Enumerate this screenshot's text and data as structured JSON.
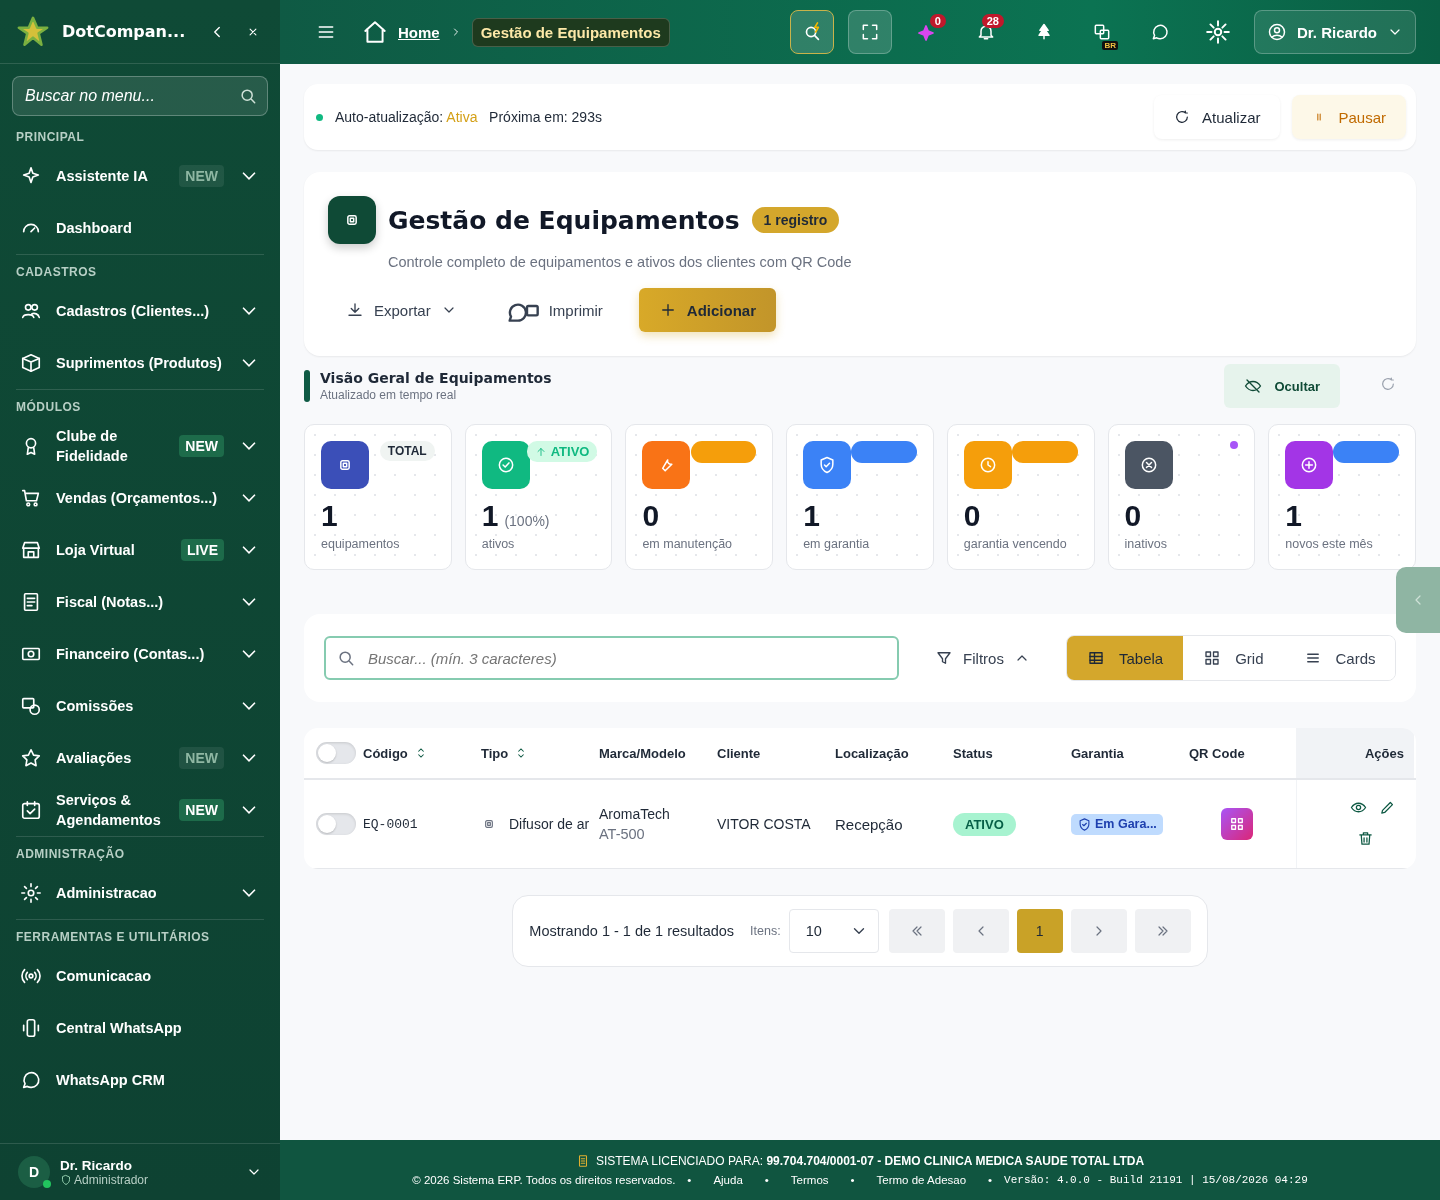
{
  "sidebar": {
    "brand": "DotCompan...",
    "search": {
      "placeholder": "Buscar no menu..."
    },
    "sections": [
      {
        "title": "PRINCIPAL",
        "items": [
          {
            "label": "Assistente IA",
            "badge": "NEW",
            "badge_dim": true,
            "expandable": true
          },
          {
            "label": "Dashboard",
            "expandable": false
          }
        ]
      },
      {
        "title": "CADASTROS",
        "items": [
          {
            "label": "Cadastros (Clientes...)",
            "expandable": true
          },
          {
            "label": "Suprimentos (Produtos)",
            "expandable": true
          }
        ]
      },
      {
        "title": "MÓDULOS",
        "items": [
          {
            "label": "Clube de Fidelidade",
            "badge": "NEW",
            "badge_dim": false,
            "expandable": true
          },
          {
            "label": "Vendas (Orçamentos...)",
            "expandable": true
          },
          {
            "label": "Loja Virtual",
            "badge": "LIVE",
            "badge_dim": false,
            "expandable": true
          },
          {
            "label": "Fiscal (Notas...)",
            "expandable": true
          },
          {
            "label": "Financeiro (Contas...)",
            "expandable": true
          },
          {
            "label": "Comissões",
            "expandable": true
          },
          {
            "label": "Avaliações",
            "badge": "NEW",
            "badge_dim": true,
            "expandable": true
          },
          {
            "label": "Serviços & Agendamentos",
            "badge": "NEW",
            "badge_dim": false,
            "expandable": true
          }
        ]
      },
      {
        "title": "ADMINISTRAÇÃO",
        "items": [
          {
            "label": "Administracao",
            "expandable": true
          }
        ]
      },
      {
        "title": "FERRAMENTAS E UTILITÁRIOS",
        "items": [
          {
            "label": "Comunicacao",
            "expandable": false
          },
          {
            "label": "Central WhatsApp",
            "expandable": false
          },
          {
            "label": "WhatsApp CRM",
            "expandable": false
          }
        ]
      }
    ],
    "user": {
      "initial": "D",
      "name": "Dr. Ricardo",
      "role": "Administrador"
    }
  },
  "header": {
    "breadcrumb": [
      {
        "label": "Home"
      },
      {
        "label": "Gestão de Equipamentos"
      }
    ],
    "ai_count": "0",
    "notifications": "28",
    "language": "BR",
    "user": "Dr. Ricardo"
  },
  "auto_refresh": {
    "label": "Auto-atualização:",
    "status": "Ativa",
    "next_label": "Próxima em:",
    "next": "293s",
    "buttons": [
      "Atualizar",
      "Pausar"
    ]
  },
  "page": {
    "title": "Gestão de Equipamentos",
    "count": "1 registro",
    "subtitle": "Controle completo de equipamentos e ativos dos clientes com QR Code",
    "actions": [
      "Exportar",
      "Imprimir",
      "Adicionar"
    ]
  },
  "overview": {
    "title": "Visão Geral de Equipamentos",
    "subtitle": "Atualizado em tempo real",
    "hide_button": "Ocultar",
    "cards": [
      {
        "value": "1",
        "label": "equipamentos",
        "color": "#3b4fb8",
        "tag": "TOTAL",
        "tag_arrow": false
      },
      {
        "value": "1",
        "extra": "(100%)",
        "label": "ativos",
        "color": "#10b981",
        "tag": "ATIVO",
        "tag_arrow": true
      },
      {
        "value": "0",
        "label": "em manutenção",
        "color": "#f97316",
        "accent": {
          "kind": "pill",
          "color": "#f59e0b"
        }
      },
      {
        "value": "1",
        "label": "em garantia",
        "color": "#3b82f6",
        "accent": {
          "kind": "pill",
          "color": "#3b82f6"
        }
      },
      {
        "value": "0",
        "label": "garantia vencendo",
        "color": "#f59e0b",
        "accent": {
          "kind": "pill",
          "color": "#f59e0b"
        }
      },
      {
        "value": "0",
        "label": "inativos",
        "color": "#4b5563",
        "accent": {
          "kind": "dot",
          "color": "#a855f7"
        }
      },
      {
        "value": "1",
        "label": "novos este mês",
        "color": "#a335e6",
        "accent": {
          "kind": "pill",
          "color": "#3b82f6"
        }
      }
    ]
  },
  "search": {
    "placeholder": "Buscar... (mín. 3 caracteres)",
    "filters": "Filtros",
    "views": [
      {
        "label": "Tabela",
        "selected": true
      },
      {
        "label": "Grid",
        "selected": false
      },
      {
        "label": "Cards",
        "selected": false
      }
    ]
  },
  "table": {
    "select_all": {
      "on": false
    },
    "columns": [
      {
        "label": "Código",
        "sortable": true
      },
      {
        "label": "Tipo",
        "sortable": true
      },
      {
        "label": "Marca/Modelo",
        "sortable": false
      },
      {
        "label": "Cliente",
        "sortable": false
      },
      {
        "label": "Localização",
        "sortable": false
      },
      {
        "label": "Status",
        "sortable": false
      },
      {
        "label": "Garantia",
        "sortable": false
      },
      {
        "label": "QR Code",
        "sortable": false
      },
      {
        "label": "Ações",
        "sortable": false
      }
    ],
    "rows": [
      {
        "on": false,
        "code": "EQ-0001",
        "type": "Difusor de ar",
        "brand": "AromaTech",
        "model": "AT-500",
        "client": "VITOR COSTA",
        "location": "Recepção",
        "status": "ATIVO",
        "warranty": "Em Gara..."
      }
    ]
  },
  "pagination": {
    "summary": "Mostrando 1 - 1 de 1 resultados",
    "items_label": "Itens:",
    "items_value": "10",
    "pages": [
      {
        "label": "1",
        "selected": true
      }
    ]
  },
  "footer": {
    "license_label": "SISTEMA LICENCIADO PARA:",
    "license": "99.704.704/0001-07 - DEMO CLINICA MEDICA SAUDE TOTAL LTDA",
    "copyright": "© 2026 Sistema ERP. Todos os direitos reservados.",
    "links": [
      "Ajuda",
      "Termos",
      "Termo de Adesao"
    ],
    "separator": "•",
    "version": "Versão: 4.0.0 - Build 21191 | 15/08/2026 04:29"
  }
}
